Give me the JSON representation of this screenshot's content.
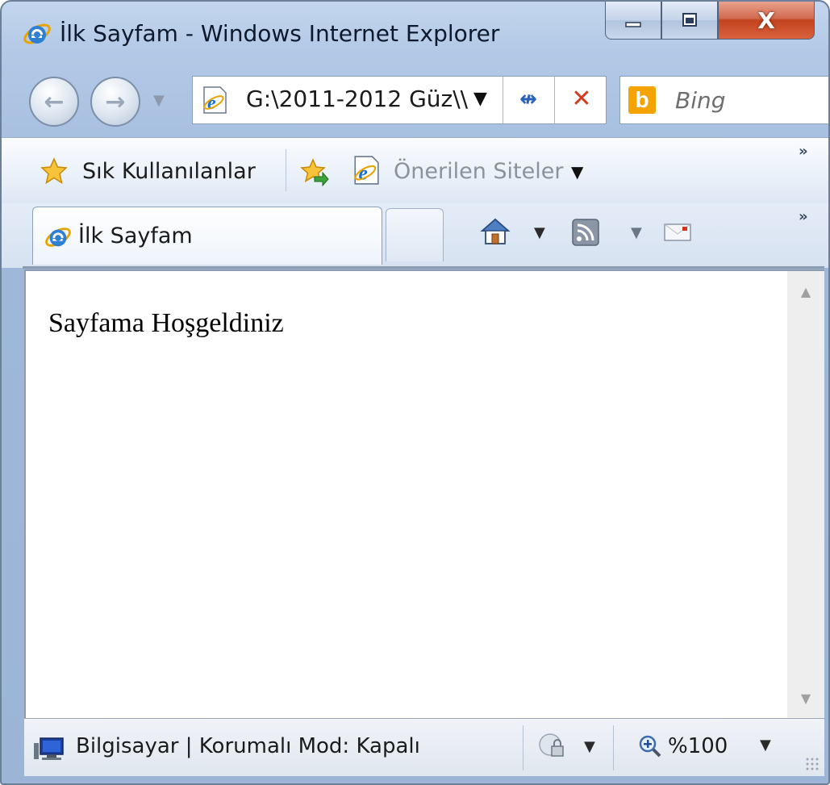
{
  "window": {
    "title": "İlk Sayfam - Windows Internet Explorer",
    "min_glyph": "▁",
    "max_glyph": "▢",
    "close_glyph": "X"
  },
  "nav": {
    "back_glyph": "←",
    "forward_glyph": "→",
    "dropdown_glyph": "▼",
    "address_value": "G:\\2011-2012 Güz\\\\",
    "address_dropdown_glyph": "▼",
    "refresh_glyph": "↮",
    "stop_glyph": "✕",
    "search_placeholder": "Bing",
    "search_logo": "b"
  },
  "favorites_bar": {
    "favorites_label": "Sık Kullanılanlar",
    "suggested_sites_label": "Önerilen Siteler",
    "dropdown_glyph": "▼",
    "overflow_glyph": "»"
  },
  "tabs": {
    "active_tab_label": "İlk Sayfam",
    "dropdown_glyph": "▼",
    "overflow_glyph": "»"
  },
  "page": {
    "body_text": "Sayfama Hoşgeldiniz"
  },
  "scrollbar": {
    "up_glyph": "▲",
    "down_glyph": "▼"
  },
  "status_bar": {
    "zone_text": "Bilgisayar | Korumalı Mod: Kapalı",
    "zoom_text": "%100",
    "dropdown_glyph": "▼"
  },
  "icons": {
    "title": "ie-logo-icon",
    "address": "ie-page-icon",
    "favorites": "favorites-star-icon",
    "add_favorites": "add-to-favorites-icon",
    "suggested_sites": "ie-suggested-sites-icon",
    "tab": "ie-tab-icon",
    "home": "home-icon",
    "feeds": "rss-feed-icon",
    "mail": "read-mail-icon",
    "status_zone": "computer-zone-icon",
    "security": "security-lock-icon",
    "zoom": "zoom-magnifier-icon"
  },
  "colors": {
    "close_button": "#c2431e",
    "accent_blue": "#2b63b6",
    "bing": "#f5a300"
  }
}
